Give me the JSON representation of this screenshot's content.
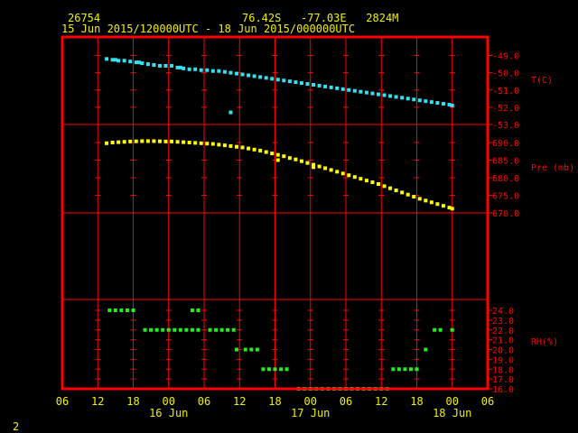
{
  "header": {
    "station": "26754",
    "location": "76.42S   -77.03E   2824M",
    "time_range": "15 Jun 2015/120000UTC - 18 Jun 2015/000000UTC"
  },
  "footer": {
    "page": "2"
  },
  "colors": {
    "frame": "#ff0000",
    "grid": "#ff0000",
    "axis_text": "#ff0000",
    "date_text": "#f0f000",
    "temperature": "#33e0f0",
    "pressure": "#ffff00",
    "humidity": "#22ee22"
  },
  "chart_data": {
    "type": "scatter",
    "x_unit": "hours from 15 Jun 06 UTC",
    "x_range": [
      0,
      72
    ],
    "x_tick_labels": [
      "06",
      "12",
      "18",
      "00",
      "06",
      "12",
      "18",
      "00",
      "06",
      "12",
      "18",
      "00",
      "06"
    ],
    "x_date_labels": [
      {
        "x": 18,
        "label": "16 Jun"
      },
      {
        "x": 42,
        "label": "17 Jun"
      },
      {
        "x": 66,
        "label": "18 Jun"
      }
    ],
    "panels": [
      {
        "name": "temperature",
        "ylabel": "T(C)",
        "ylim": [
          -53,
          -48
        ],
        "yticks": [
          -49,
          -50,
          -51,
          -52,
          -53
        ],
        "ytick_labels": [
          "-49.0",
          "-50.0",
          "-51.0",
          "-52.0",
          "-53.0"
        ],
        "points": [
          [
            7.5,
            -49.2
          ],
          [
            8.5,
            -49.25
          ],
          [
            9,
            -49.25
          ],
          [
            9.5,
            -49.3
          ],
          [
            10.5,
            -49.3
          ],
          [
            11.5,
            -49.35
          ],
          [
            12.5,
            -49.4
          ],
          [
            13,
            -49.4
          ],
          [
            13.5,
            -49.45
          ],
          [
            14.5,
            -49.5
          ],
          [
            15.5,
            -49.55
          ],
          [
            16.5,
            -49.6
          ],
          [
            17.5,
            -49.6
          ],
          [
            18.5,
            -49.6
          ],
          [
            19.5,
            -49.7
          ],
          [
            20,
            -49.7
          ],
          [
            20.5,
            -49.75
          ],
          [
            21.5,
            -49.8
          ],
          [
            22.5,
            -49.8
          ],
          [
            23.5,
            -49.85
          ],
          [
            24.5,
            -49.85
          ],
          [
            25.5,
            -49.9
          ],
          [
            26.5,
            -49.9
          ],
          [
            27.5,
            -49.95
          ],
          [
            28.5,
            -50.0
          ],
          [
            29.5,
            -50.05
          ],
          [
            30.5,
            -50.1
          ],
          [
            31.5,
            -50.15
          ],
          [
            32.5,
            -50.2
          ],
          [
            33.5,
            -50.25
          ],
          [
            34.5,
            -50.3
          ],
          [
            35.5,
            -50.35
          ],
          [
            36.5,
            -50.4
          ],
          [
            37.5,
            -50.45
          ],
          [
            38.5,
            -50.5
          ],
          [
            39.5,
            -50.55
          ],
          [
            40.5,
            -50.6
          ],
          [
            41.5,
            -50.65
          ],
          [
            42.5,
            -50.7
          ],
          [
            43.5,
            -50.75
          ],
          [
            44.5,
            -50.8
          ],
          [
            45.5,
            -50.85
          ],
          [
            46.5,
            -50.9
          ],
          [
            47.5,
            -50.95
          ],
          [
            48.5,
            -51.0
          ],
          [
            49.5,
            -51.05
          ],
          [
            50.5,
            -51.1
          ],
          [
            51.5,
            -51.15
          ],
          [
            52.5,
            -51.2
          ],
          [
            53.5,
            -51.25
          ],
          [
            54.5,
            -51.3
          ],
          [
            55.5,
            -51.35
          ],
          [
            56.5,
            -51.4
          ],
          [
            57.5,
            -51.45
          ],
          [
            58.5,
            -51.5
          ],
          [
            59.5,
            -51.55
          ],
          [
            60.5,
            -51.6
          ],
          [
            61.5,
            -51.65
          ],
          [
            62.5,
            -51.7
          ],
          [
            63.5,
            -51.75
          ],
          [
            64.5,
            -51.8
          ],
          [
            65.5,
            -51.85
          ],
          [
            66,
            -51.9
          ],
          [
            28.5,
            -52.3
          ]
        ]
      },
      {
        "name": "pressure",
        "ylabel": "Pre (mb)",
        "ylim": [
          670,
          693
        ],
        "yticks": [
          690,
          685,
          680,
          675,
          670
        ],
        "ytick_labels": [
          "690.0",
          "685.0",
          "680.0",
          "675.0",
          "670.0"
        ],
        "points": [
          [
            7.5,
            689.8
          ],
          [
            8.5,
            690.0
          ],
          [
            9.5,
            690.1
          ],
          [
            10.5,
            690.2
          ],
          [
            11.5,
            690.3
          ],
          [
            12.5,
            690.35
          ],
          [
            13.5,
            690.4
          ],
          [
            14.5,
            690.4
          ],
          [
            15.5,
            690.4
          ],
          [
            16.5,
            690.35
          ],
          [
            17.5,
            690.3
          ],
          [
            18.5,
            690.3
          ],
          [
            19.5,
            690.2
          ],
          [
            20.5,
            690.1
          ],
          [
            21.5,
            690.0
          ],
          [
            22.5,
            689.9
          ],
          [
            23.5,
            689.8
          ],
          [
            24.5,
            689.7
          ],
          [
            25.5,
            689.6
          ],
          [
            26.5,
            689.4
          ],
          [
            27.5,
            689.2
          ],
          [
            28.5,
            689.0
          ],
          [
            29.5,
            688.8
          ],
          [
            30.5,
            688.6
          ],
          [
            31.5,
            688.3
          ],
          [
            32.5,
            688.0
          ],
          [
            33.5,
            687.7
          ],
          [
            34.5,
            687.3
          ],
          [
            35.5,
            686.9
          ],
          [
            36.5,
            686.5
          ],
          [
            37.5,
            686.1
          ],
          [
            38.5,
            685.6
          ],
          [
            39.5,
            685.2
          ],
          [
            40.5,
            684.7
          ],
          [
            41.5,
            684.2
          ],
          [
            42.5,
            683.7
          ],
          [
            43.5,
            683.2
          ],
          [
            44.5,
            682.7
          ],
          [
            45.5,
            682.2
          ],
          [
            46.5,
            681.7
          ],
          [
            47.5,
            681.2
          ],
          [
            48.5,
            680.7
          ],
          [
            49.5,
            680.2
          ],
          [
            50.5,
            679.7
          ],
          [
            51.5,
            679.2
          ],
          [
            52.5,
            678.7
          ],
          [
            53.5,
            678.2
          ],
          [
            54.5,
            677.6
          ],
          [
            55.5,
            677.0
          ],
          [
            56.5,
            676.4
          ],
          [
            57.5,
            675.8
          ],
          [
            58.5,
            675.2
          ],
          [
            59.5,
            674.6
          ],
          [
            60.5,
            674.0
          ],
          [
            61.5,
            673.5
          ],
          [
            62.5,
            673.0
          ],
          [
            63.5,
            672.5
          ],
          [
            64.5,
            672.0
          ],
          [
            65.5,
            671.5
          ],
          [
            66,
            671.2
          ],
          [
            36.5,
            685.0
          ],
          [
            42.5,
            683.0
          ]
        ]
      },
      {
        "name": "relative_humidity",
        "ylabel": "RH(%)",
        "ylim": [
          16,
          24
        ],
        "yticks": [
          24,
          23,
          22,
          21,
          20,
          19,
          18,
          17,
          16
        ],
        "ytick_labels": [
          "24.0",
          "23.0",
          "22.0",
          "21.0",
          "20.0",
          "19.0",
          "18.0",
          "17.0",
          "16.0"
        ],
        "points": [
          [
            8,
            24
          ],
          [
            9,
            24
          ],
          [
            10,
            24
          ],
          [
            11,
            24
          ],
          [
            12,
            24
          ],
          [
            14,
            22
          ],
          [
            15,
            22
          ],
          [
            16,
            22
          ],
          [
            17,
            22
          ],
          [
            18,
            22
          ],
          [
            19,
            22
          ],
          [
            20,
            22
          ],
          [
            21,
            22
          ],
          [
            22,
            22
          ],
          [
            23,
            22
          ],
          [
            22,
            24
          ],
          [
            23,
            24
          ],
          [
            25,
            22
          ],
          [
            26,
            22
          ],
          [
            27,
            22
          ],
          [
            28,
            22
          ],
          [
            29,
            22
          ],
          [
            29.5,
            20
          ],
          [
            31,
            20
          ],
          [
            32,
            20
          ],
          [
            33,
            20
          ],
          [
            34,
            18
          ],
          [
            35,
            18
          ],
          [
            36,
            18
          ],
          [
            37,
            18
          ],
          [
            38,
            18
          ],
          [
            40,
            16
          ],
          [
            41,
            16
          ],
          [
            42,
            16
          ],
          [
            43,
            16
          ],
          [
            44,
            16
          ],
          [
            45,
            16
          ],
          [
            46,
            16
          ],
          [
            47,
            16
          ],
          [
            48,
            16
          ],
          [
            49,
            16
          ],
          [
            50,
            16
          ],
          [
            51,
            16
          ],
          [
            52,
            16
          ],
          [
            53,
            16
          ],
          [
            54,
            16
          ],
          [
            55,
            16
          ],
          [
            56,
            18
          ],
          [
            57,
            18
          ],
          [
            58,
            18
          ],
          [
            59,
            18
          ],
          [
            60,
            18
          ],
          [
            61.5,
            20
          ],
          [
            63,
            22
          ],
          [
            64,
            22
          ],
          [
            66,
            22
          ]
        ]
      }
    ]
  }
}
